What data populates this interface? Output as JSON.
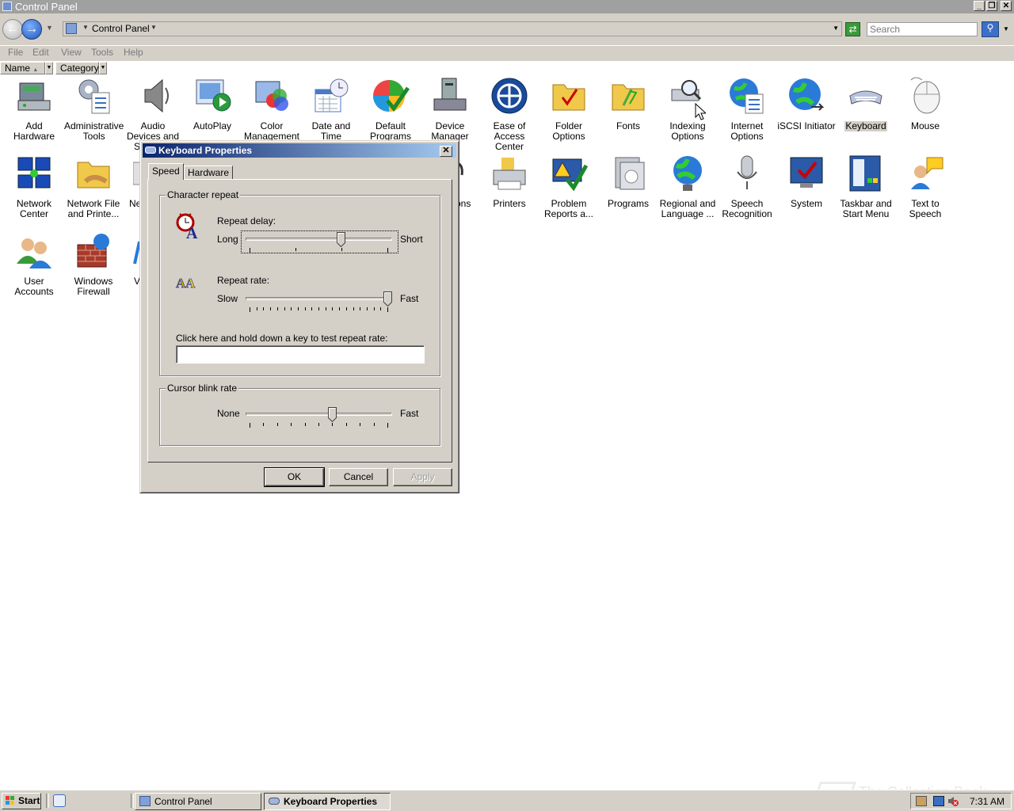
{
  "window": {
    "title": "Control Panel"
  },
  "address": {
    "crumb": "Control Panel",
    "search_placeholder": "Search"
  },
  "menu": [
    "File",
    "Edit",
    "View",
    "Tools",
    "Help"
  ],
  "columns": {
    "name": "Name",
    "category": "Category"
  },
  "items": [
    {
      "label": "Add Hardware",
      "icon": "add-hardware-icon"
    },
    {
      "label": "Administrative Tools",
      "icon": "administrative-tools-icon"
    },
    {
      "label": "Audio Devices and Sound ...",
      "icon": "speaker-icon"
    },
    {
      "label": "AutoPlay",
      "icon": "autoplay-icon"
    },
    {
      "label": "Color Management",
      "icon": "color-management-icon"
    },
    {
      "label": "Date and Time",
      "icon": "calendar-clock-icon"
    },
    {
      "label": "Default Programs",
      "icon": "default-programs-icon"
    },
    {
      "label": "Device Manager",
      "icon": "device-manager-icon"
    },
    {
      "label": "Ease of Access Center",
      "icon": "ease-of-access-icon"
    },
    {
      "label": "Folder Options",
      "icon": "folder-options-icon"
    },
    {
      "label": "Fonts",
      "icon": "fonts-folder-icon"
    },
    {
      "label": "Indexing Options",
      "icon": "indexing-options-icon"
    },
    {
      "label": "Internet Options",
      "icon": "internet-options-icon"
    },
    {
      "label": "iSCSI Initiator",
      "icon": "iscsi-globe-icon"
    },
    {
      "label": "Keyboard",
      "icon": "keyboard-icon"
    },
    {
      "label": "Mouse",
      "icon": "mouse-icon"
    },
    {
      "label": "Network Center",
      "icon": "network-center-icon"
    },
    {
      "label": "Network File and Printe...",
      "icon": "network-file-folder-icon"
    },
    {
      "label": "Ne",
      "icon": "partial-hidden-icon"
    },
    {
      "label": "tions",
      "icon": "partial-hidden-icon"
    },
    {
      "label": "Printers",
      "icon": "printer-icon"
    },
    {
      "label": "Problem Reports a...",
      "icon": "problem-reports-icon"
    },
    {
      "label": "Programs",
      "icon": "programs-icon"
    },
    {
      "label": "Regional and Language ...",
      "icon": "regional-globe-icon"
    },
    {
      "label": "Speech Recognition",
      "icon": "microphone-icon"
    },
    {
      "label": "System",
      "icon": "system-icon"
    },
    {
      "label": "Taskbar and Start Menu",
      "icon": "taskbar-start-menu-icon"
    },
    {
      "label": "Text to Speech",
      "icon": "text-to-speech-icon"
    },
    {
      "label": "User Accounts",
      "icon": "user-accounts-icon"
    },
    {
      "label": "Windows Firewall",
      "icon": "firewall-icon"
    },
    {
      "label": "V",
      "icon": "partial-hidden-icon"
    }
  ],
  "dialog": {
    "title": "Keyboard Properties",
    "tabs": [
      "Speed",
      "Hardware"
    ],
    "character_repeat": {
      "group": "Character repeat",
      "delay_label": "Repeat delay:",
      "delay_min": "Long",
      "delay_max": "Short",
      "delay_level": 0.66,
      "rate_label": "Repeat rate:",
      "rate_min": "Slow",
      "rate_max": "Fast",
      "rate_level": 1.0,
      "test_label": "Click here and hold down a key to test repeat rate:",
      "test_value": ""
    },
    "cursor_blink": {
      "group": "Cursor blink rate",
      "min": "None",
      "max": "Fast",
      "level": 0.6
    },
    "buttons": {
      "ok": "OK",
      "cancel": "Cancel",
      "apply": "Apply"
    }
  },
  "taskbar": {
    "start": "Start",
    "tasks": [
      "Control Panel",
      "Keyboard Properties"
    ],
    "clock": "7:31 AM"
  },
  "watermark": "The Collection Book"
}
